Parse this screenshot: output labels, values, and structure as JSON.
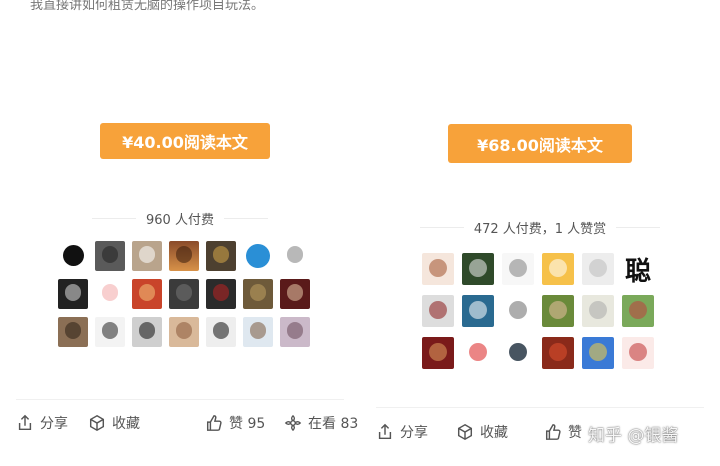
{
  "left": {
    "intro_text": "我直接讲如何租赁无脑的操作项目玩法。",
    "pay_button": "¥40.00阅读本文",
    "paid_count": "960 人付费",
    "share_label": "分享",
    "collect_label": "收藏",
    "like_label": "赞 95",
    "watching_label": "在看 83"
  },
  "right": {
    "pay_button": "¥68.00阅读本文",
    "paid_count": "472 人付费，1 人赞赏",
    "share_label": "分享",
    "collect_label": "收藏",
    "like_label": "赞",
    "watermark": "知乎 @银酱",
    "calligraphy_char": "聪"
  },
  "colors": {
    "accent": "#f7a23a",
    "text_secondary": "#555555"
  }
}
